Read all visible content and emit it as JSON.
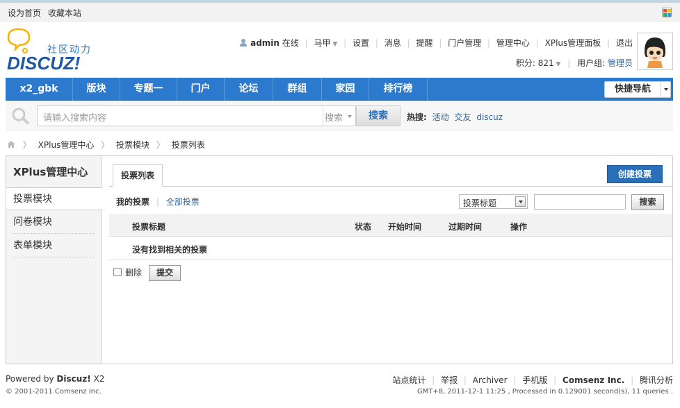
{
  "toolbar": {
    "set_home": "设为首页",
    "bookmark": "收藏本站"
  },
  "logo": {
    "slogan": "社区动力",
    "brand": "DISCUZ!"
  },
  "user": {
    "name": "admin",
    "status": "在线",
    "menu": [
      "马甲",
      "设置",
      "消息",
      "提醒",
      "门户管理",
      "管理中心",
      "XPlus管理面板",
      "退出"
    ],
    "points_label": "积分: 821",
    "group_label": "用户组:",
    "group_value": "管理员"
  },
  "nav": {
    "items": [
      "x2_gbk",
      "版块",
      "专题一",
      "门户",
      "论坛",
      "群组",
      "家园",
      "排行榜"
    ],
    "quick": "快捷导航"
  },
  "search": {
    "placeholder": "请输入搜索内容",
    "type": "搜索",
    "button": "搜索",
    "hot_label": "热搜:",
    "hot_links": [
      "活动",
      "交友",
      "discuz"
    ]
  },
  "breadcrumb": [
    "XPlus管理中心",
    "投票模块",
    "投票列表"
  ],
  "sidebar": {
    "title": "XPlus管理中心",
    "items": [
      "投票模块",
      "问卷模块",
      "表单模块"
    ]
  },
  "content": {
    "tab": "投票列表",
    "create_button": "创建投票",
    "filter_mine": "我的投票",
    "filter_all": "全部投票",
    "select_value": "投票标题",
    "search_button": "搜索",
    "columns": [
      "投票标题",
      "状态",
      "开始时间",
      "过期时间",
      "操作"
    ],
    "empty_text": "没有找到相关的投票",
    "delete_label": "删除",
    "submit_button": "提交"
  },
  "footer": {
    "powered_prefix": "Powered by",
    "powered_brand": "Discuz!",
    "powered_ver": "X2",
    "copyright": "© 2001-2011 Comsenz Inc.",
    "links": [
      "站点统计",
      "举报",
      "Archiver",
      "手机版"
    ],
    "company": "Comsenz Inc.",
    "analytics": "腾讯分析",
    "debug": "GMT+8, 2011-12-1 11:25 , Processed in 0.129001 second(s), 11 queries ."
  },
  "colors": {
    "nav_bg": "#2b7acd",
    "link": "#336699",
    "primary_button": "#2b6fb6"
  }
}
